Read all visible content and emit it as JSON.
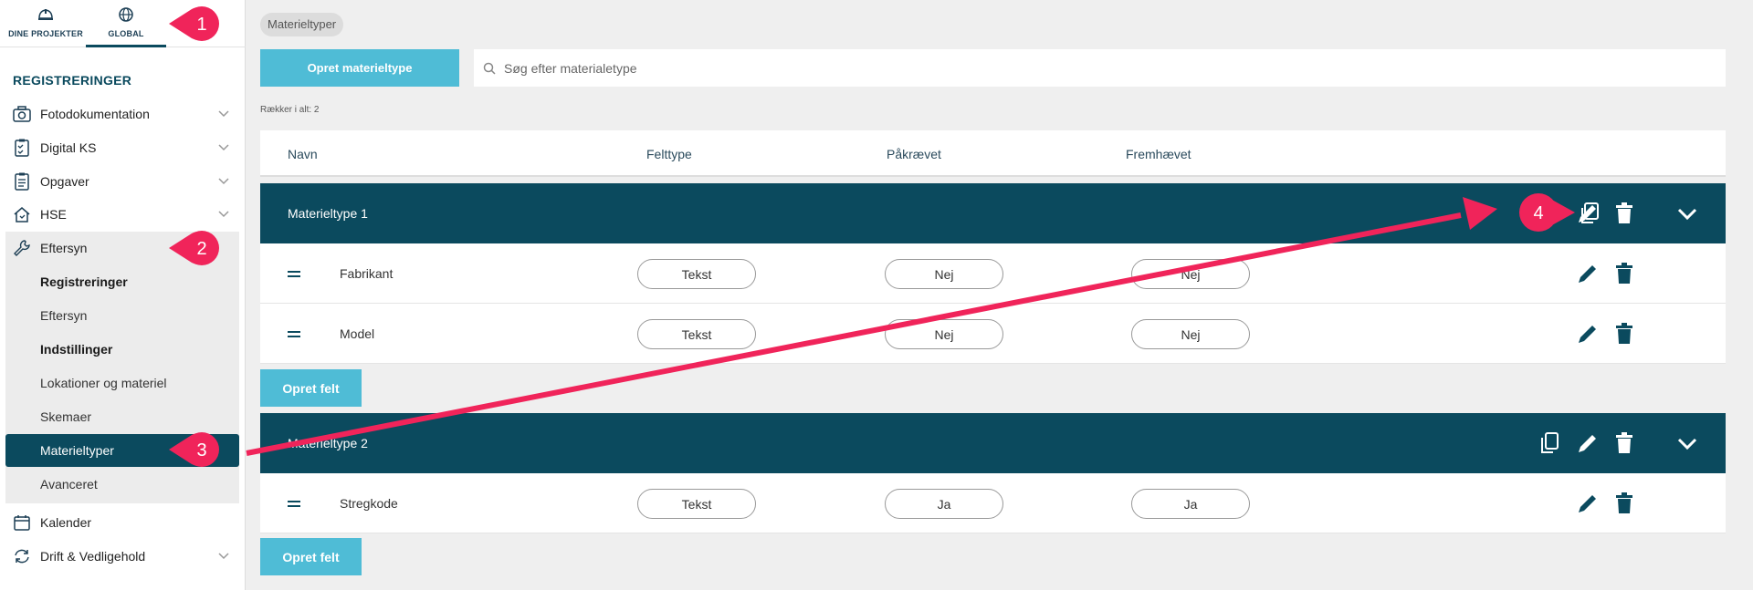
{
  "sidebar": {
    "tabs": [
      {
        "label": "DINE PROJEKTER",
        "icon": "helmet-icon"
      },
      {
        "label": "GLOBAL",
        "icon": "globe-icon"
      }
    ],
    "section_title": "REGISTRERINGER",
    "items": [
      {
        "label": "Fotodokumentation",
        "icon": "camera-icon"
      },
      {
        "label": "Digital KS",
        "icon": "clipboard-check-icon"
      },
      {
        "label": "Opgaver",
        "icon": "clipboard-list-icon"
      },
      {
        "label": "HSE",
        "icon": "house-icon"
      },
      {
        "label": "Eftersyn",
        "icon": "wrench-icon"
      }
    ],
    "sub_items": [
      {
        "label": "Registreringer"
      },
      {
        "label": "Eftersyn"
      },
      {
        "label": "Indstillinger"
      },
      {
        "label": "Lokationer og materiel"
      },
      {
        "label": "Skemaer"
      },
      {
        "label": "Materieltyper"
      },
      {
        "label": "Avanceret"
      }
    ],
    "bottom_items": [
      {
        "label": "Kalender",
        "icon": "calendar-icon"
      },
      {
        "label": "Drift & Vedligehold",
        "icon": "sync-icon"
      }
    ]
  },
  "breadcrumb": "Materieltyper",
  "toolbar": {
    "create_label": "Opret materieltype",
    "search_placeholder": "Søg efter materialetype"
  },
  "row_count": "Rækker i alt: 2",
  "columns": [
    "Navn",
    "Felttype",
    "Påkrævet",
    "Fremhævet"
  ],
  "groups": [
    {
      "name": "Materieltype 1",
      "fields": [
        {
          "name": "Fabrikant",
          "type": "Tekst",
          "required": "Nej",
          "highlighted": "Nej"
        },
        {
          "name": "Model",
          "type": "Tekst",
          "required": "Nej",
          "highlighted": "Nej"
        }
      ],
      "add_field_label": "Opret felt"
    },
    {
      "name": "Materieltype 2",
      "fields": [
        {
          "name": "Stregkode",
          "type": "Tekst",
          "required": "Ja",
          "highlighted": "Ja"
        }
      ],
      "add_field_label": "Opret felt"
    }
  ],
  "annotations": [
    "1",
    "2",
    "3",
    "4"
  ],
  "colors": {
    "primary_dark": "#0b4a5e",
    "accent_button": "#4fbcd6",
    "annotation": "#f0245a",
    "background": "#efefef"
  }
}
